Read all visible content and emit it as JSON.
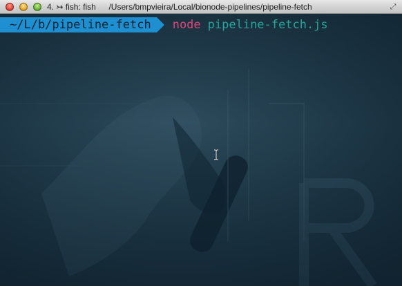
{
  "window": {
    "tab_index": "4.",
    "tab_glyph": "↣",
    "session_title": "fish: fish",
    "path": "/Users/bmpvieira/Local/bionode-pipelines/pipeline-fetch",
    "resize_icon": "resize-diagonal-icon"
  },
  "terminal": {
    "prompt_cwd": "~/L/b/pipeline-fetch",
    "command": "node",
    "argument": "pipeline-fetch.js"
  },
  "colors": {
    "prompt_bg": "#1e8fd1",
    "command": "#e2467a",
    "argument": "#2aa39a",
    "background": "#1b3240"
  }
}
